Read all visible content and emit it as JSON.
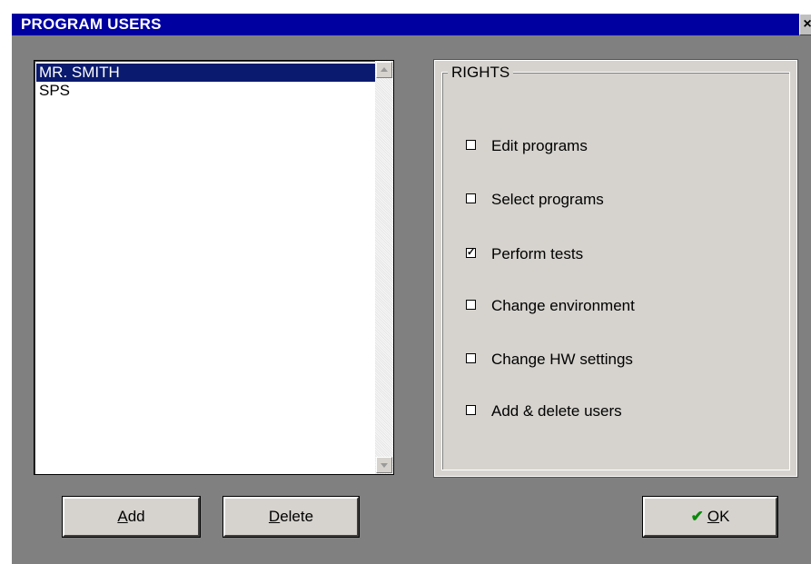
{
  "window": {
    "title": "PROGRAM USERS",
    "close_glyph": "×"
  },
  "users": {
    "items": [
      {
        "name": "MR. SMITH",
        "selected": true
      },
      {
        "name": "SPS",
        "selected": false
      }
    ]
  },
  "rights": {
    "legend": "RIGHTS",
    "options": [
      {
        "label": "Edit programs",
        "checked": false
      },
      {
        "label": "Select programs",
        "checked": false
      },
      {
        "label": "Perform tests",
        "checked": true
      },
      {
        "label": "Change environment",
        "checked": false
      },
      {
        "label": "Change HW settings",
        "checked": false
      },
      {
        "label": "Add & delete users",
        "checked": false
      }
    ]
  },
  "buttons": {
    "add": {
      "mnemonic": "A",
      "rest": "dd"
    },
    "delete": {
      "mnemonic": "D",
      "rest": "elete"
    },
    "ok": {
      "icon": "checkmark-icon",
      "mnemonic": "O",
      "rest": "K"
    }
  },
  "colors": {
    "titlebar": "#0000a0",
    "selection": "#0a1a6e",
    "dialog_bg": "#808080",
    "panel_bg": "#d6d3ce",
    "ok_check": "#0a8a0a"
  }
}
